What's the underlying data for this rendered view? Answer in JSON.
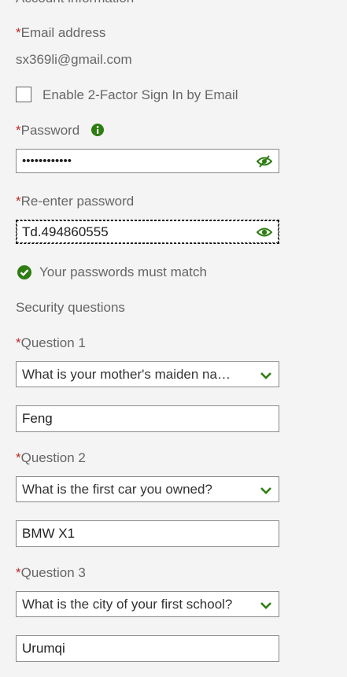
{
  "section_title": "Account information",
  "required_marker": "*",
  "email": {
    "label": "Email address",
    "value": "sx369li@gmail.com"
  },
  "two_factor": {
    "label": "Enable 2-Factor Sign In by Email",
    "checked": false
  },
  "password": {
    "label": "Password",
    "masked_value": "••••••••••••",
    "info_icon": "info-icon",
    "toggle_icon": "eye-slash-icon"
  },
  "reenter_password": {
    "label": "Re-enter password",
    "value": "Td.494860555",
    "toggle_icon": "eye-icon"
  },
  "match_status": {
    "icon": "check-circle-icon",
    "text": "Your passwords must match"
  },
  "security": {
    "heading": "Security questions",
    "questions": [
      {
        "label": "Question 1",
        "selected": "What is your mother's maiden name?",
        "answer": "Feng"
      },
      {
        "label": "Question 2",
        "selected": "What is the first car you owned?",
        "answer": "BMW X1"
      },
      {
        "label": "Question 3",
        "selected": "What is the city of your first school?",
        "answer": "Urumqi"
      }
    ]
  },
  "colors": {
    "accent_green": "#2e7d12",
    "required_red": "#c62828"
  }
}
